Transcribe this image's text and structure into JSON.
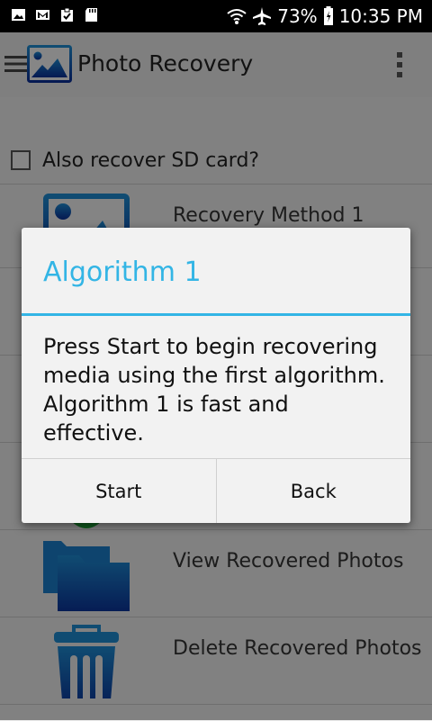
{
  "status_bar": {
    "left_icons": [
      "image-icon",
      "gmail-icon",
      "clipboard-icon",
      "sd-card-icon"
    ],
    "right_icons": [
      "wifi-icon",
      "airplane-icon",
      "battery-icon"
    ],
    "battery_text": "73%",
    "time": "10:35 PM"
  },
  "app_bar": {
    "title": "Photo Recovery",
    "icons": [
      "menu-icon",
      "photo-logo-icon",
      "overflow-menu-icon"
    ]
  },
  "main": {
    "sd_checkbox": {
      "label": "Also recover SD card?",
      "checked": false
    },
    "list": [
      {
        "label": "Recovery Method 1",
        "icon": "image-icon"
      },
      {
        "label": "",
        "icon": ""
      },
      {
        "label": "",
        "icon": ""
      },
      {
        "label": "",
        "icon": ""
      },
      {
        "label": "View Recovered Photos",
        "icon": "folder-icon"
      },
      {
        "label": "Delete Recovered Photos",
        "icon": "trash-icon"
      }
    ]
  },
  "dialog": {
    "title": "Algorithm 1",
    "message": "Press Start to begin recovering media using the first algorithm. Algorithm 1 is fast and effective.",
    "buttons": {
      "start": "Start",
      "back": "Back"
    }
  },
  "colors": {
    "accent": "#33b5e5",
    "icon_blue_top": "#1e8ad0",
    "icon_blue_bottom": "#0a2f96",
    "status_bar": "#000000"
  }
}
